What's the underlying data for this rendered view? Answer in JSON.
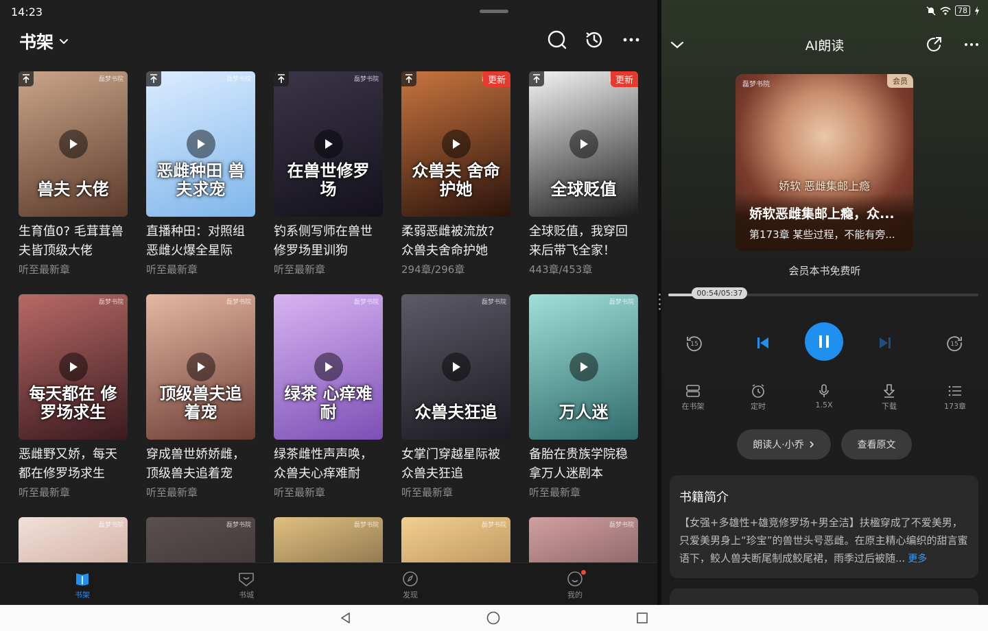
{
  "status": {
    "time": "14:23",
    "battery": "78"
  },
  "shelf": {
    "title": "书架",
    "books": [
      {
        "title": "生育值0? 毛茸茸兽夫皆顶级大佬",
        "sub": "听至最新章",
        "cover_text": "兽夫 大佬",
        "pinned": true,
        "update": false,
        "c1": "#c9a58a",
        "c2": "#5b3a2b"
      },
      {
        "title": "直播种田：对照组恶雌火爆全星际",
        "sub": "听至最新章",
        "cover_text": "恶雌种田 兽夫求宠",
        "pinned": true,
        "update": false,
        "c1": "#dcecff",
        "c2": "#7fb6ea"
      },
      {
        "title": "钓系侧写师在兽世修罗场里训狗",
        "sub": "听至最新章",
        "cover_text": "在兽世修罗场",
        "pinned": true,
        "update": false,
        "c1": "#3b3548",
        "c2": "#14111c"
      },
      {
        "title": "柔弱恶雌被流放? 众兽夫舍命护她",
        "sub": "294章/296章",
        "cover_text": "众兽夫 舍命护她",
        "pinned": true,
        "update": true,
        "c1": "#c9753f",
        "c2": "#2a130b"
      },
      {
        "title": "全球贬值，我穿回来后带飞全家！",
        "sub": "443章/453章",
        "cover_text": "全球贬值",
        "pinned": true,
        "update": true,
        "c1": "#f4f4f4",
        "c2": "#1b1b1b"
      },
      {
        "title": "恶雌野又娇，每天都在修罗场求生",
        "sub": "听至最新章",
        "cover_text": "每天都在 修罗场求生",
        "pinned": false,
        "update": false,
        "c1": "#b86a66",
        "c2": "#3a1a1f"
      },
      {
        "title": "穿成兽世娇娇雌，顶级兽夫追着宠",
        "sub": "听至最新章",
        "cover_text": "顶级兽夫追着宠",
        "pinned": false,
        "update": false,
        "c1": "#e6b7a3",
        "c2": "#6b3c33"
      },
      {
        "title": "绿茶雌性声声唤，众兽夫心痒难耐",
        "sub": "听至最新章",
        "cover_text": "绿茶 心痒难耐",
        "pinned": false,
        "update": false,
        "c1": "#d8b4f2",
        "c2": "#7c4fb5"
      },
      {
        "title": "女掌门穿越星际被众兽夫狂追",
        "sub": "听至最新章",
        "cover_text": "众兽夫狂追",
        "pinned": false,
        "update": false,
        "c1": "#5c5b66",
        "c2": "#1b1a21"
      },
      {
        "title": "备胎在贵族学院稳拿万人迷剧本",
        "sub": "听至最新章",
        "cover_text": "万人迷",
        "pinned": false,
        "update": false,
        "c1": "#9fe0d8",
        "c2": "#2e6a6a"
      },
      {
        "title": "",
        "sub": "",
        "cover_text": "",
        "pinned": false,
        "update": false,
        "c1": "#f0e0d8",
        "c2": "#b58070"
      },
      {
        "title": "",
        "sub": "",
        "cover_text": "",
        "pinned": false,
        "update": false,
        "c1": "#5a5050",
        "c2": "#2a2222"
      },
      {
        "title": "",
        "sub": "",
        "cover_text": "",
        "pinned": false,
        "update": false,
        "c1": "#e0c080",
        "c2": "#3a2a1a"
      },
      {
        "title": "",
        "sub": "",
        "cover_text": "",
        "pinned": false,
        "update": false,
        "c1": "#f0d090",
        "c2": "#8a5a30"
      },
      {
        "title": "",
        "sub": "",
        "cover_text": "",
        "pinned": false,
        "update": false,
        "c1": "#d0a0a0",
        "c2": "#4a2a30"
      }
    ],
    "update_label": "更新"
  },
  "bottom_nav": [
    {
      "label": "书架",
      "active": true
    },
    {
      "label": "书城",
      "active": false
    },
    {
      "label": "发现",
      "active": false
    },
    {
      "label": "我的",
      "active": false
    }
  ],
  "player": {
    "title": "AI朗读",
    "vip_badge": "会员",
    "cover_art_text": "娇软 恶雌集邮上瘾",
    "book_title": "娇软恶雌集邮上瘾，众...",
    "chapter": "第173章 某些过程，不能有旁...",
    "free_listen": "会员本书免费听",
    "time": "00:54/05:37",
    "progress": 0.16,
    "skip_back": "15",
    "skip_forward": "15",
    "functions": [
      {
        "label": "在书架",
        "icon": "bookshelf-icon"
      },
      {
        "label": "定时",
        "icon": "alarm-clock-icon"
      },
      {
        "label": "1.5X",
        "icon": "speed-icon"
      },
      {
        "label": "下载",
        "icon": "download-icon"
      },
      {
        "label": "173章",
        "icon": "chapter-list-icon"
      }
    ],
    "narrator": "朗读人·小乔",
    "view_original": "查看原文",
    "intro_title": "书籍简介",
    "intro_text": "【女强+多雄性+雄竞修罗场+男全洁】扶楹穿成了不爱美男，只爱美男身上“珍宝”的兽世头号恶雌。在原主精心编织的甜言蜜语下，鲛人兽夫断尾制成鲛尾裙，雨季过后被随...",
    "more": "更多"
  },
  "colors": {
    "accent": "#1f8ff0",
    "update": "#e63a2e"
  }
}
